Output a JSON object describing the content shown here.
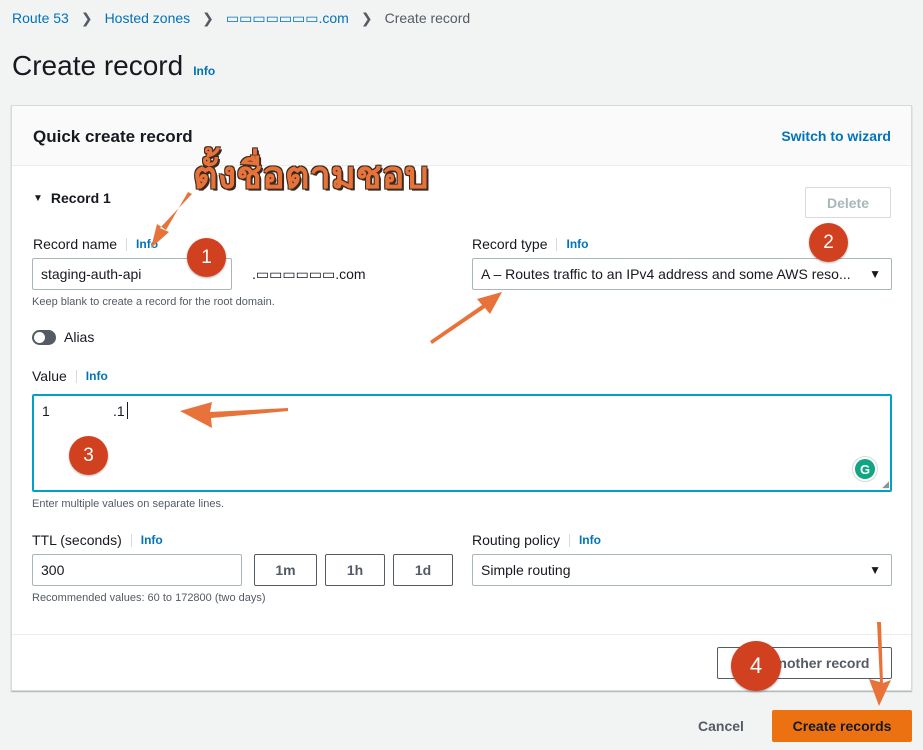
{
  "breadcrumb": {
    "items": [
      "Route 53",
      "Hosted zones",
      "▭▭▭▭▭▭▭.com"
    ],
    "current": "Create record"
  },
  "page": {
    "title": "Create record",
    "info": "Info"
  },
  "panel": {
    "title": "Quick create record",
    "switch_link": "Switch to wizard",
    "record_toggle": "Record 1",
    "delete_label": "Delete"
  },
  "record_name": {
    "label": "Record name",
    "info": "Info",
    "value": "staging-auth-api",
    "domain_suffix": ".▭▭▭▭▭▭.com",
    "hint": "Keep blank to create a record for the root domain."
  },
  "record_type": {
    "label": "Record type",
    "info": "Info",
    "value": "A – Routes traffic to an IPv4 address and some AWS reso..."
  },
  "alias": {
    "label": "Alias",
    "enabled": false
  },
  "value_field": {
    "label": "Value",
    "info": "Info",
    "value_prefix": "1",
    "value_suffix": ".1",
    "hint": "Enter multiple values on separate lines."
  },
  "ttl": {
    "label": "TTL (seconds)",
    "info": "Info",
    "value": "300",
    "presets": [
      "1m",
      "1h",
      "1d"
    ],
    "hint": "Recommended values: 60 to 172800 (two days)"
  },
  "routing_policy": {
    "label": "Routing policy",
    "info": "Info",
    "value": "Simple routing"
  },
  "add_another": "Add another record",
  "footer": {
    "cancel": "Cancel",
    "create": "Create records"
  },
  "annotations": {
    "thai_note": "ตั้งชื่อตามชอบ",
    "steps": [
      "1",
      "2",
      "3",
      "4"
    ]
  },
  "colors": {
    "link": "#0073bb",
    "primary_button": "#ec7211",
    "callout": "#d2411f",
    "arrow": "#e8733a"
  }
}
